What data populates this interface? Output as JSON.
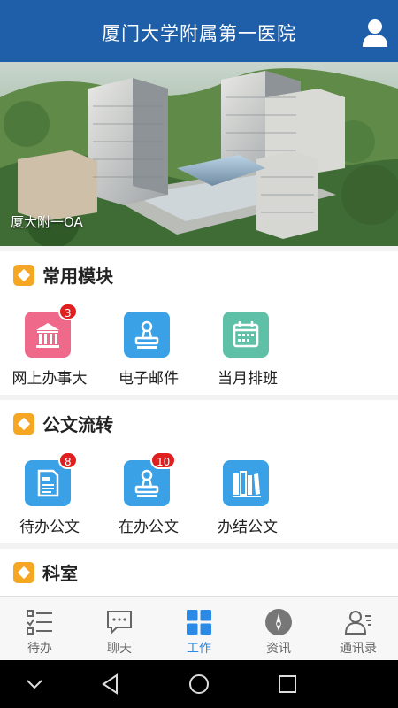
{
  "header": {
    "title": "厦门大学附属第一医院",
    "user_icon": "user-icon"
  },
  "banner": {
    "caption": "厦大附一OA"
  },
  "sections": [
    {
      "title": "常用模块",
      "items": [
        {
          "label": "网上办事大",
          "icon": "bank-icon",
          "color": "#ef6a8a",
          "badge": "3"
        },
        {
          "label": "电子邮件",
          "icon": "stamp-icon",
          "color": "#3aa1e6",
          "badge": ""
        },
        {
          "label": "当月排班",
          "icon": "calendar-icon",
          "color": "#5fc0a8",
          "badge": ""
        }
      ]
    },
    {
      "title": "公文流转",
      "items": [
        {
          "label": "待办公文",
          "icon": "document-icon",
          "color": "#3aa1e6",
          "badge": "8"
        },
        {
          "label": "在办公文",
          "icon": "stamp-icon",
          "color": "#3aa1e6",
          "badge": "10"
        },
        {
          "label": "办结公文",
          "icon": "books-icon",
          "color": "#3aa1e6",
          "badge": ""
        }
      ]
    },
    {
      "title": "科室",
      "items": []
    }
  ],
  "tabs": [
    {
      "label": "待办",
      "icon": "checklist-icon",
      "active": false
    },
    {
      "label": "聊天",
      "icon": "chat-icon",
      "active": false
    },
    {
      "label": "工作",
      "icon": "grid-icon",
      "active": true
    },
    {
      "label": "资讯",
      "icon": "compass-icon",
      "active": false
    },
    {
      "label": "通讯录",
      "icon": "contacts-icon",
      "active": false
    }
  ],
  "colors": {
    "header": "#1f5ea8",
    "accent": "#2a8ae6",
    "section_marker": "#f5a623",
    "badge": "#e02020"
  }
}
